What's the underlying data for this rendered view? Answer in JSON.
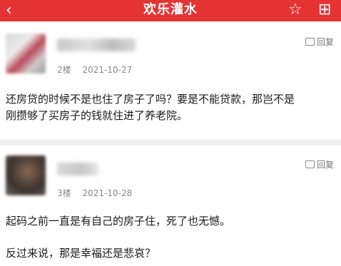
{
  "header": {
    "title": "欢乐灌水",
    "back_icon": "‹",
    "star_icon": "☆",
    "more_icon": "⊞"
  },
  "posts": [
    {
      "floor": "2楼",
      "date": "2021-10-27",
      "reply_label": "回复",
      "lines": [
        "还房贷的时候不是也住了房子了吗？要是不能贷款，那岂不是",
        "刚攒够了买房子的钱就住进了养老院。"
      ]
    },
    {
      "floor": "3楼",
      "date": "2021-10-28",
      "reply_label": "回复",
      "lines": [
        "起码之前一直是有自己的房子住，死了也无憾。",
        "反过来说，那是幸福还是悲哀？"
      ]
    }
  ],
  "colors": {
    "accent": "#e53333"
  }
}
